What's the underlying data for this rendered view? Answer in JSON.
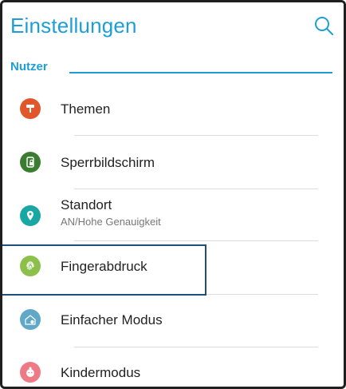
{
  "header": {
    "title": "Einstellungen",
    "search_icon": "search-icon"
  },
  "section": {
    "label": "Nutzer"
  },
  "items": [
    {
      "label": "Themen",
      "icon": "paint-roller-icon",
      "color": "#e2572a"
    },
    {
      "label": "Sperrbildschirm",
      "icon": "lock-screen-icon",
      "color": "#3a7d31"
    },
    {
      "label": "Standort",
      "sublabel": "AN/Hohe Genauigkeit",
      "icon": "location-pin-icon",
      "color": "#18a7a2"
    },
    {
      "label": "Fingerabdruck",
      "icon": "fingerprint-icon",
      "color": "#8cc04b"
    },
    {
      "label": "Einfacher Modus",
      "icon": "easy-mode-icon",
      "color": "#5fa8c8"
    },
    {
      "label": "Kindermodus",
      "icon": "kid-mode-icon",
      "color": "#ee7a86"
    }
  ],
  "colors": {
    "accent": "#1e9ed8",
    "highlight_border": "#1f4f7a"
  }
}
